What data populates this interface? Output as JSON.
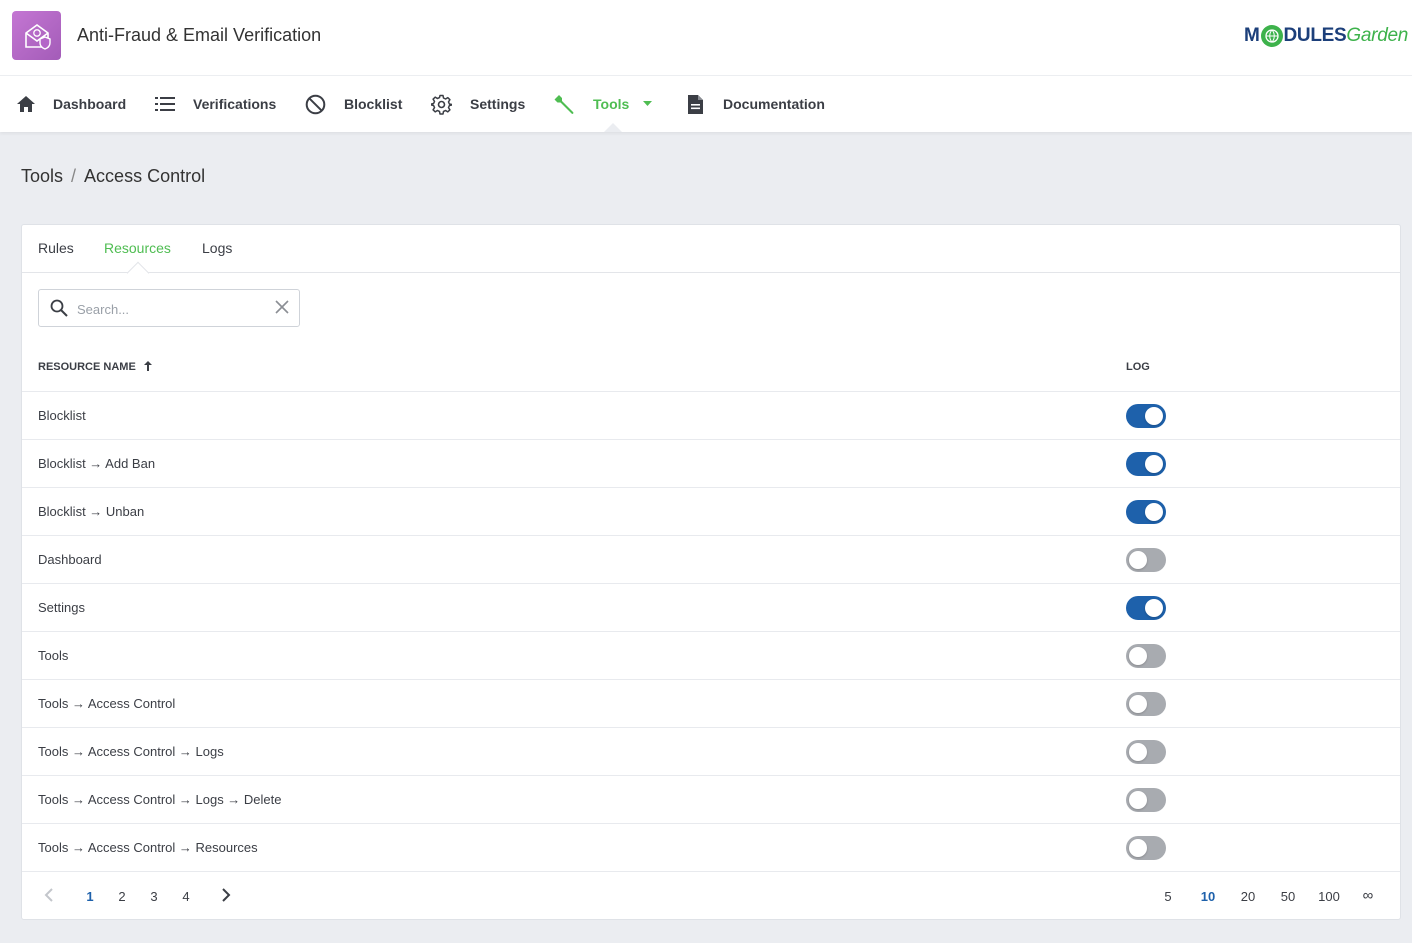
{
  "app": {
    "title": "Anti-Fraud & Email Verification",
    "brand_main": "M",
    "brand_rest": "DULES",
    "brand_garden": "Garden",
    "brand_color": "#1c3f7a",
    "accent_green": "#4fbd52"
  },
  "nav": {
    "items": [
      {
        "label": "Dashboard",
        "icon": "home-icon"
      },
      {
        "label": "Verifications",
        "icon": "list-icon"
      },
      {
        "label": "Blocklist",
        "icon": "block-icon"
      },
      {
        "label": "Settings",
        "icon": "gear-icon"
      },
      {
        "label": "Tools",
        "icon": "wrench-icon",
        "active": true,
        "dropdown": true
      },
      {
        "label": "Documentation",
        "icon": "document-icon"
      }
    ]
  },
  "breadcrumb": {
    "parent": "Tools",
    "separator": "/",
    "current": "Access Control"
  },
  "tabs": [
    {
      "label": "Rules"
    },
    {
      "label": "Resources",
      "active": true
    },
    {
      "label": "Logs"
    }
  ],
  "search": {
    "placeholder": "Search...",
    "value": ""
  },
  "table": {
    "columns": {
      "name": "RESOURCE NAME",
      "log": "LOG"
    },
    "sort": "ascending",
    "rows": [
      {
        "name": "Blocklist",
        "log": true
      },
      {
        "name": "Blocklist → Add Ban",
        "log": true
      },
      {
        "name": "Blocklist → Unban",
        "log": true
      },
      {
        "name": "Dashboard",
        "log": false
      },
      {
        "name": "Settings",
        "log": true
      },
      {
        "name": "Tools",
        "log": false
      },
      {
        "name": "Tools → Access Control",
        "log": false
      },
      {
        "name": "Tools → Access Control → Logs",
        "log": false
      },
      {
        "name": "Tools → Access Control → Logs → Delete",
        "log": false
      },
      {
        "name": "Tools → Access Control → Resources",
        "log": false
      }
    ]
  },
  "pagination": {
    "pages": [
      "1",
      "2",
      "3",
      "4"
    ],
    "current_page": "1",
    "per_page_options": [
      "5",
      "10",
      "20",
      "50",
      "100",
      "∞"
    ],
    "current_per_page": "10"
  },
  "colors": {
    "toggle_on": "#1e61ab",
    "toggle_off": "#a8abb0"
  }
}
